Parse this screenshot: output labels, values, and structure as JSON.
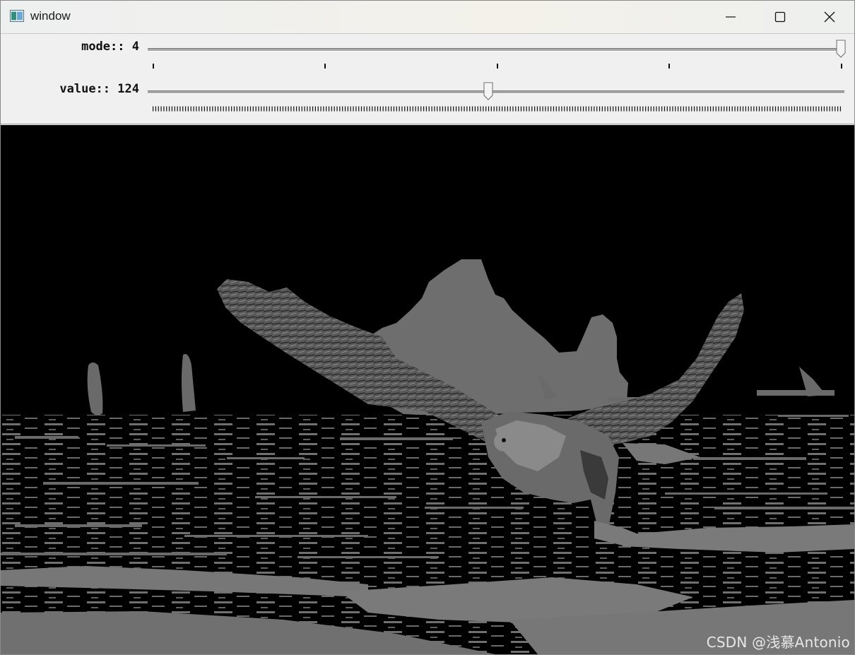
{
  "window": {
    "title": "window",
    "icon": "opencv-window-icon",
    "controls": [
      "minimize-icon",
      "maximize-icon",
      "close-icon"
    ]
  },
  "trackbars": [
    {
      "label": "mode::",
      "value": "4",
      "min": 0,
      "max": 4,
      "position": 4
    },
    {
      "label": "value::",
      "value": "124",
      "min": 0,
      "max": 255,
      "position": 124
    }
  ],
  "image": {
    "description_kind": "thresholded grayscale photo",
    "watermark": "CSDN @浅慕Antonio"
  },
  "colors": {
    "background": "#000000",
    "foreground_gray": "#6e6e6e",
    "panel": "#f0f0f0"
  }
}
